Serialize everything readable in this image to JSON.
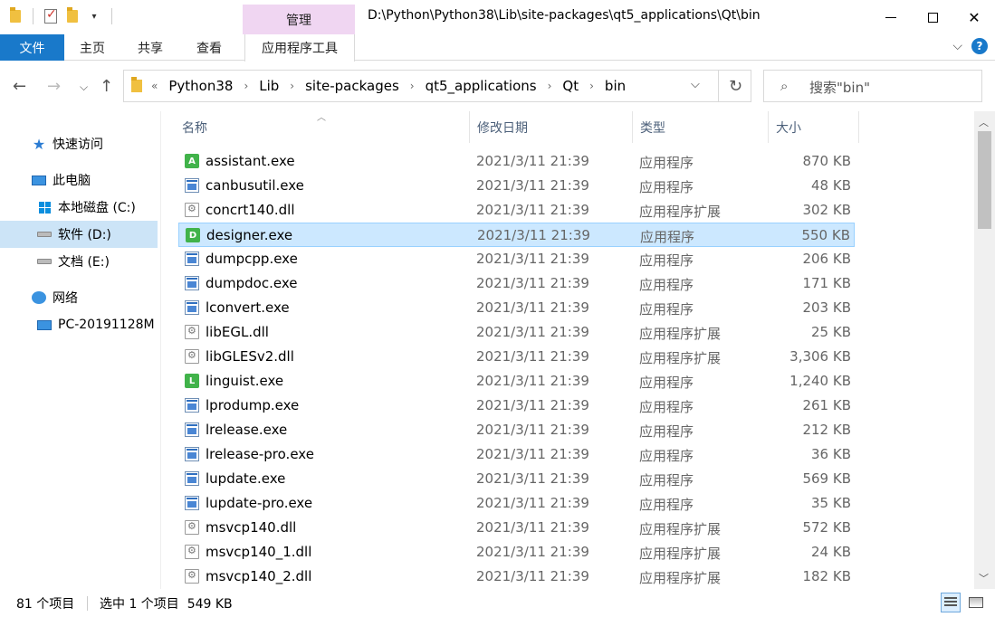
{
  "titlebar": {
    "manage_tab": "管理",
    "path": "D:\\Python\\Python38\\Lib\\site-packages\\qt5_applications\\Qt\\bin",
    "minimize": "",
    "maximize": "",
    "close": "✕"
  },
  "ribbon": {
    "tabs": [
      "文件",
      "主页",
      "共享",
      "查看",
      "应用程序工具"
    ],
    "help": "?"
  },
  "address": {
    "prefix": "«",
    "crumbs": [
      "Python38",
      "Lib",
      "site-packages",
      "qt5_applications",
      "Qt",
      "bin"
    ],
    "separator": "›",
    "search_placeholder": "搜索\"bin\""
  },
  "navpane": {
    "items": [
      {
        "label": "快速访问",
        "icon": "star-icon"
      },
      {
        "label": "此电脑",
        "icon": "computer-icon"
      },
      {
        "label": "本地磁盘 (C:)",
        "icon": "windows-drive-icon"
      },
      {
        "label": "软件 (D:)",
        "icon": "drive-icon",
        "selected": true
      },
      {
        "label": "文档 (E:)",
        "icon": "drive-icon"
      },
      {
        "label": "网络",
        "icon": "network-icon"
      },
      {
        "label": "PC-20191128M",
        "icon": "computer-icon"
      }
    ]
  },
  "columns": {
    "name": "名称",
    "date": "修改日期",
    "type": "类型",
    "size": "大小"
  },
  "files": [
    {
      "name": "assistant.exe",
      "date": "2021/3/11 21:39",
      "type": "应用程序",
      "size": "870 KB",
      "icon": "qt-app-icon",
      "letter": "A"
    },
    {
      "name": "canbusutil.exe",
      "date": "2021/3/11 21:39",
      "type": "应用程序",
      "size": "48 KB",
      "icon": "exe-icon"
    },
    {
      "name": "concrt140.dll",
      "date": "2021/3/11 21:39",
      "type": "应用程序扩展",
      "size": "302 KB",
      "icon": "dll-icon"
    },
    {
      "name": "designer.exe",
      "date": "2021/3/11 21:39",
      "type": "应用程序",
      "size": "550 KB",
      "icon": "qt-app-icon",
      "letter": "D",
      "selected": true
    },
    {
      "name": "dumpcpp.exe",
      "date": "2021/3/11 21:39",
      "type": "应用程序",
      "size": "206 KB",
      "icon": "exe-icon"
    },
    {
      "name": "dumpdoc.exe",
      "date": "2021/3/11 21:39",
      "type": "应用程序",
      "size": "171 KB",
      "icon": "exe-icon"
    },
    {
      "name": "lconvert.exe",
      "date": "2021/3/11 21:39",
      "type": "应用程序",
      "size": "203 KB",
      "icon": "exe-icon"
    },
    {
      "name": "libEGL.dll",
      "date": "2021/3/11 21:39",
      "type": "应用程序扩展",
      "size": "25 KB",
      "icon": "dll-icon"
    },
    {
      "name": "libGLESv2.dll",
      "date": "2021/3/11 21:39",
      "type": "应用程序扩展",
      "size": "3,306 KB",
      "icon": "dll-icon"
    },
    {
      "name": "linguist.exe",
      "date": "2021/3/11 21:39",
      "type": "应用程序",
      "size": "1,240 KB",
      "icon": "qt-app-icon",
      "letter": "L"
    },
    {
      "name": "lprodump.exe",
      "date": "2021/3/11 21:39",
      "type": "应用程序",
      "size": "261 KB",
      "icon": "exe-icon"
    },
    {
      "name": "lrelease.exe",
      "date": "2021/3/11 21:39",
      "type": "应用程序",
      "size": "212 KB",
      "icon": "exe-icon"
    },
    {
      "name": "lrelease-pro.exe",
      "date": "2021/3/11 21:39",
      "type": "应用程序",
      "size": "36 KB",
      "icon": "exe-icon"
    },
    {
      "name": "lupdate.exe",
      "date": "2021/3/11 21:39",
      "type": "应用程序",
      "size": "569 KB",
      "icon": "exe-icon"
    },
    {
      "name": "lupdate-pro.exe",
      "date": "2021/3/11 21:39",
      "type": "应用程序",
      "size": "35 KB",
      "icon": "exe-icon"
    },
    {
      "name": "msvcp140.dll",
      "date": "2021/3/11 21:39",
      "type": "应用程序扩展",
      "size": "572 KB",
      "icon": "dll-icon"
    },
    {
      "name": "msvcp140_1.dll",
      "date": "2021/3/11 21:39",
      "type": "应用程序扩展",
      "size": "24 KB",
      "icon": "dll-icon"
    },
    {
      "name": "msvcp140_2.dll",
      "date": "2021/3/11 21:39",
      "type": "应用程序扩展",
      "size": "182 KB",
      "icon": "dll-icon"
    }
  ],
  "status": {
    "count": "81 个项目",
    "selection": "选中 1 个项目  549 KB"
  },
  "colors": {
    "file_tab": "#1979ca",
    "manage_tab": "#f0d6f2",
    "selection": "#cce8ff",
    "nav_selection": "#cce4f7"
  }
}
